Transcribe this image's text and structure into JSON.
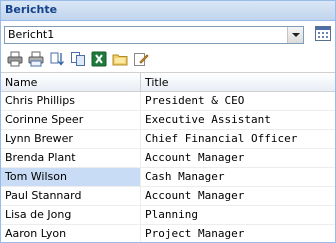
{
  "panel": {
    "title": "Berichte"
  },
  "report_select": {
    "value": "Bericht1"
  },
  "toolbar": {
    "buttons": [
      {
        "name": "print-icon"
      },
      {
        "name": "print-preview-icon"
      },
      {
        "name": "sort-icon"
      },
      {
        "name": "copy-icon"
      },
      {
        "name": "excel-export-icon"
      },
      {
        "name": "folder-icon"
      },
      {
        "name": "edit-report-icon"
      }
    ]
  },
  "grid": {
    "columns": [
      "Name",
      "Title"
    ],
    "rows": [
      {
        "name": "Chris Phillips",
        "title": "President & CEO"
      },
      {
        "name": "Corinne Speer",
        "title": "Executive Assistant"
      },
      {
        "name": "Lynn Brewer",
        "title": "Chief Financial Officer"
      },
      {
        "name": "Brenda Plant",
        "title": "Account Manager"
      },
      {
        "name": "Tom Wilson",
        "title": "Cash Manager"
      },
      {
        "name": "Paul Stannard",
        "title": "Account Manager"
      },
      {
        "name": "Lisa de Jong",
        "title": "Planning"
      },
      {
        "name": "Aaron Lyon",
        "title": "Project Manager"
      }
    ],
    "selected_row_index": 4
  },
  "colors": {
    "header_text": "#15428b",
    "border": "#99bbe8",
    "selected_row": "#c8dcf6"
  }
}
